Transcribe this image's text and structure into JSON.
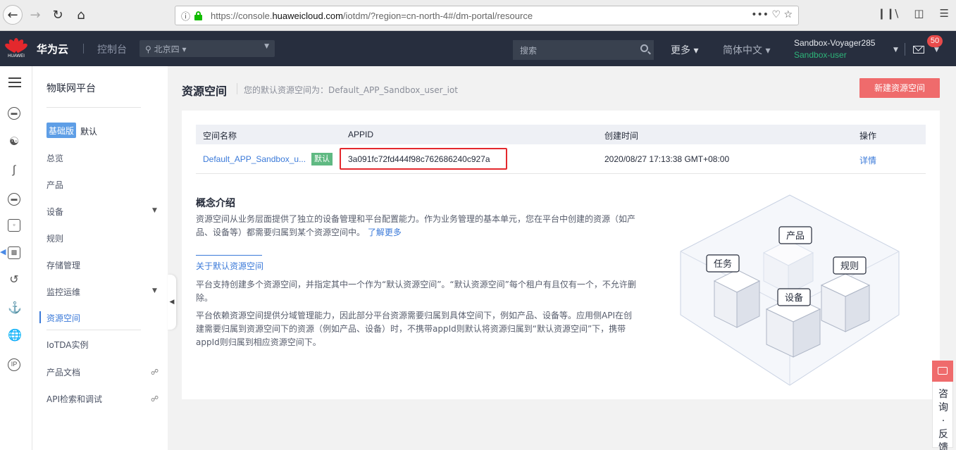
{
  "browser": {
    "url_prefix": "https://console.",
    "url_domain": "huaweicloud.com",
    "url_rest": "/iotdm/?region=cn-north-4#/dm-portal/resource",
    "url_actions": "••• ♡ ☆"
  },
  "header": {
    "brand_logo": "HUAWEI",
    "brand_name": "华为云",
    "console": "控制台",
    "region": "北京四",
    "search_placeholder": "搜索",
    "more": "更多",
    "language": "简体中文",
    "username": "Sandbox-Voyager285",
    "user_role": "Sandbox-user",
    "mail_count": "50"
  },
  "sidebar": {
    "title": "物联网平台",
    "edition": "基础版",
    "edition_name": "默认",
    "items": [
      {
        "label": "总览"
      },
      {
        "label": "产品"
      },
      {
        "label": "设备"
      },
      {
        "label": "规则"
      },
      {
        "label": "存储管理"
      },
      {
        "label": "监控运维"
      },
      {
        "label": "资源空间"
      },
      {
        "label": "IoTDA实例"
      },
      {
        "label": "产品文档"
      },
      {
        "label": "API检索和调试"
      }
    ]
  },
  "page": {
    "title": "资源空间",
    "subtitle": "您的默认资源空间为：Default_APP_Sandbox_user_iot",
    "create_button": "新建资源空间"
  },
  "table": {
    "columns": [
      "空间名称",
      "APPID",
      "创建时间",
      "操作"
    ],
    "rows": [
      {
        "name": "Default_APP_Sandbox_u...",
        "tag": "默认",
        "appid": "3a091fc72fd444f98c762686240c927a",
        "created": "2020/08/27 17:13:38 GMT+08:00",
        "action": "详情"
      }
    ]
  },
  "concept": {
    "title": "概念介绍",
    "p1": "资源空间从业务层面提供了独立的设备管理和平台配置能力。作为业务管理的基本单元，您在平台中创建的资源（如产品、设备等）都需要归属到某个资源空间中。",
    "learn_more": "了解更多",
    "about_link": "关于默认资源空间",
    "p2": "平台支持创建多个资源空间，并指定其中一个作为“默认资源空间”。“默认资源空间”每个租户有且仅有一个，不允许删除。",
    "p3": "平台依赖资源空间提供分域管理能力，因此部分平台资源需要归属到具体空间下，例如产品、设备等。应用侧API在创建需要归属到资源空间下的资源（例如产品、设备）时，不携带appId则默认将资源归属到“默认资源空间”下，携带appId则归属到相应资源空间下。"
  },
  "illustration": {
    "labels": [
      "产品",
      "任务",
      "规则",
      "设备"
    ]
  },
  "feedback": {
    "text": "咨询·反馈"
  },
  "colors": {
    "header_bg": "#272e3e",
    "accent_red": "#ef6b6c",
    "link_blue": "#3b7ad9",
    "tag_green": "#5fb982",
    "highlight_red": "#e4282d"
  }
}
